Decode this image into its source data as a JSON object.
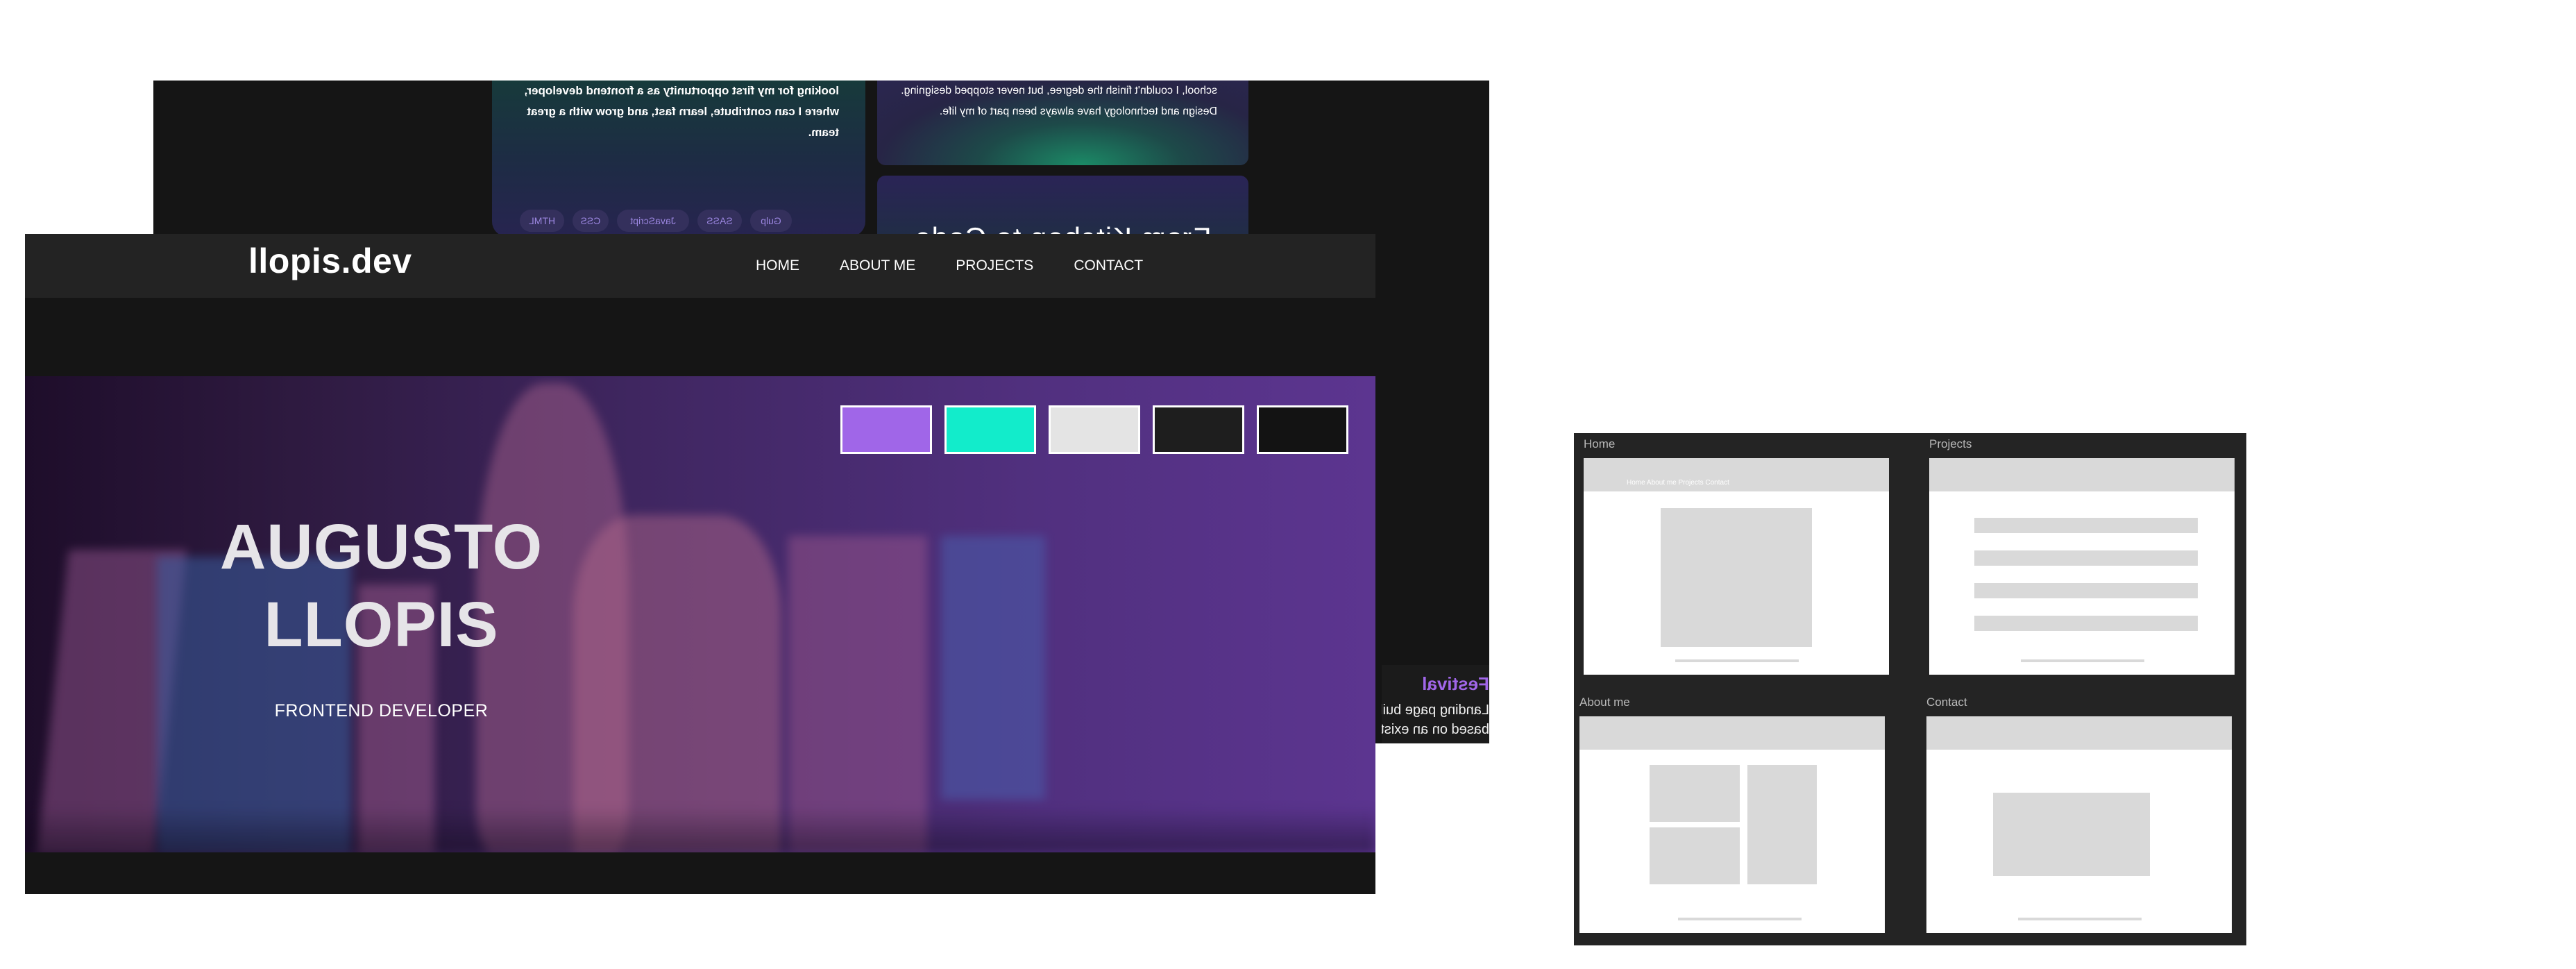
{
  "back_screenshot": {
    "about_card_text": "looking for my first opportunity as a frontend developer, where I can contribute, learn fast, and grow with a great team.",
    "tags": [
      "HTML",
      "CSS",
      "JavaScript",
      "SASS",
      "Gulp"
    ],
    "story_card_text": "school, I couldn't finish the degree, but never stopped designing. Design and technology have always been part of my life.",
    "story_heading": "From Kitchen to Code",
    "project_title": "Festival",
    "project_desc_line1": "Landing page built with",
    "project_desc_line2": "based on an existing"
  },
  "front_screenshot": {
    "logo": "llopis.dev",
    "nav": [
      "HOME",
      "ABOUT ME",
      "PROJECTS",
      "CONTACT"
    ],
    "hero": {
      "title_line1": "AUGUSTO",
      "title_line2": "LLOPIS",
      "subtitle": "FRONTEND DEVELOPER"
    },
    "palette": [
      "#a066e8",
      "#12eccb",
      "#e4e4e4",
      "#1e1e1e",
      "#131313"
    ]
  },
  "wireframes": {
    "home_label": "Home",
    "projects_label": "Projects",
    "about_label": "About me",
    "contact_label": "Contact",
    "home_nav_text": "Home About me Projects Contact"
  }
}
